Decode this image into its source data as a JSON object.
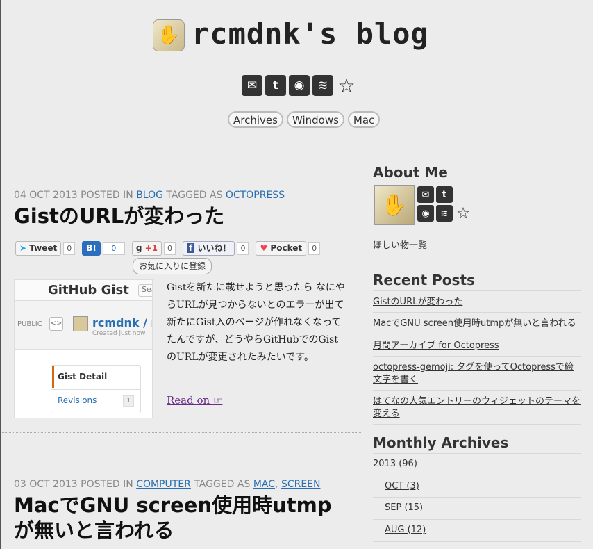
{
  "header": {
    "title": "rcmdnk's blog",
    "icons": [
      "mail-icon",
      "twitter-icon",
      "github-icon",
      "rss-icon",
      "star-icon"
    ],
    "nav": [
      "Archives",
      "Windows",
      "Mac"
    ]
  },
  "posts": [
    {
      "date": "04 OCT 2013",
      "posted_in_label": "POSTED IN",
      "category": "BLOG",
      "tagged_as_label": "TAGGED AS",
      "tags": [
        "OCTOPRESS"
      ],
      "title": "GistのURLが変わった",
      "share": [
        {
          "label": "Tweet",
          "count": "0"
        },
        {
          "label": "B!",
          "count": "0"
        },
        {
          "label": "+1",
          "count": "0"
        },
        {
          "label": "いいね！",
          "count": "0"
        },
        {
          "label": "Pocket",
          "count": "0"
        }
      ],
      "tooltip": "お気に入りに登録",
      "thumbnail": {
        "brand": "GitHub Gist",
        "search": "Sea",
        "public": "PUBLIC",
        "user": "rcmdnk / my",
        "created": "Created just now",
        "detail": "Gist Detail",
        "revisions": "Revisions",
        "revisions_count": "1"
      },
      "excerpt": "Gistを新たに載せようと思ったら なにやらURLが見つからないとのエラーが出て 新たにGist入のページが作れなくなってたんですが、どうやらGitHubでのGistのURLが変更されたみたいです。",
      "read_on": "Read on"
    },
    {
      "date": "03 OCT 2013",
      "posted_in_label": "POSTED IN",
      "category": "COMPUTER",
      "tagged_as_label": "TAGGED AS",
      "tags": [
        "MAC",
        "SCREEN"
      ],
      "title_line1": "MacでGNU screen使用時utmp",
      "title_line2": "が無いと言われる"
    }
  ],
  "sidebar": {
    "about_title": "About Me",
    "wishlist": "ほしい物一覧",
    "recent_title": "Recent Posts",
    "recent": [
      "GistのURLが変わった",
      "MacでGNU screen使用時utmpが無いと言われる",
      "月間アーカイブ for Octopress",
      "octopress-gemoji: タグを使ってOctopressで絵文字を書く",
      "はてなの人気エントリーのウィジェットのテーマを変える"
    ],
    "archives_title": "Monthly Archives",
    "archives_year": "2013 (96)",
    "archives_months": [
      "OCT (3)",
      "SEP (15)",
      "AUG (12)"
    ]
  }
}
